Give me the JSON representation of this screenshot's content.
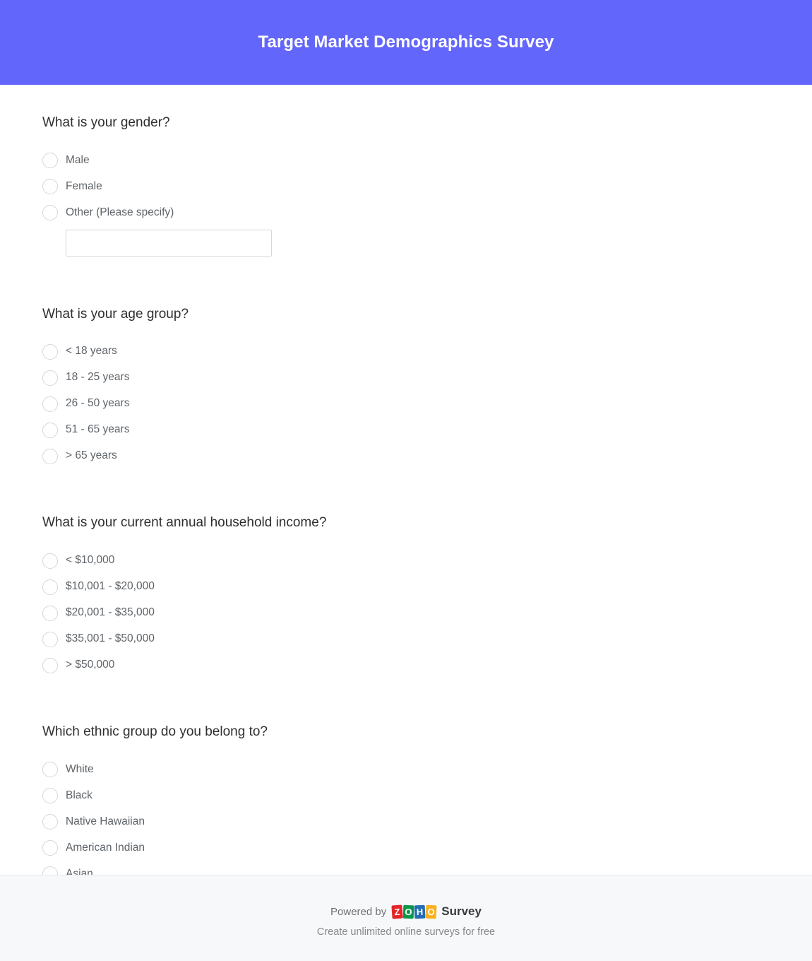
{
  "header": {
    "title": "Target Market Demographics Survey",
    "background_color": "#6366fa",
    "text_color": "#ffffff"
  },
  "questions": [
    {
      "id": "gender",
      "title": "What is your gender?",
      "type": "radio",
      "options": [
        {
          "label": "Male"
        },
        {
          "label": "Female"
        },
        {
          "label": "Other (Please specify)"
        }
      ],
      "other_input": {
        "value": "",
        "placeholder": ""
      }
    },
    {
      "id": "age-group",
      "title": "What is your age group?",
      "type": "radio",
      "options": [
        {
          "label": "< 18 years"
        },
        {
          "label": "18 - 25 years"
        },
        {
          "label": "26 - 50 years"
        },
        {
          "label": "51 - 65 years"
        },
        {
          "label": "> 65 years"
        }
      ]
    },
    {
      "id": "household-income",
      "title": "What is your current annual household income?",
      "type": "radio",
      "options": [
        {
          "label": "< $10,000"
        },
        {
          "label": "$10,001 - $20,000"
        },
        {
          "label": "$20,001 - $35,000"
        },
        {
          "label": "$35,001 - $50,000"
        },
        {
          "label": "> $50,000"
        }
      ]
    },
    {
      "id": "ethnic-group",
      "title": "Which ethnic group do you belong to?",
      "type": "radio",
      "options": [
        {
          "label": "White"
        },
        {
          "label": "Black"
        },
        {
          "label": "Native Hawaiian"
        },
        {
          "label": "American Indian"
        },
        {
          "label": "Asian"
        }
      ]
    }
  ],
  "footer": {
    "powered_by": "Powered by",
    "brand_tiles": [
      {
        "letter": "Z",
        "color": "#e42527"
      },
      {
        "letter": "O",
        "color": "#089949"
      },
      {
        "letter": "H",
        "color": "#226db4"
      },
      {
        "letter": "O",
        "color": "#f9b21d"
      }
    ],
    "brand_product": "Survey",
    "tagline": "Create unlimited online surveys for free",
    "background_color": "#f7f8f9"
  }
}
